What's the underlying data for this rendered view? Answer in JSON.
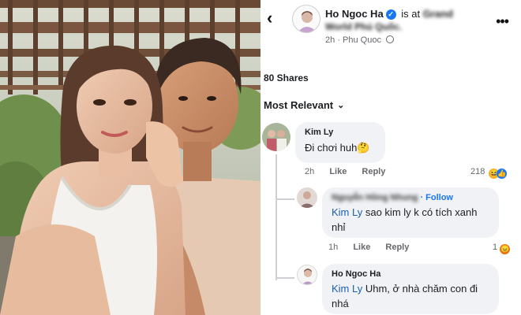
{
  "post": {
    "author": "Ho Ngoc Ha",
    "verified_icon": "✓",
    "is_at": "is at",
    "location_line1": "Grand",
    "location_line2": "World Phú Quốc.",
    "time": "2h",
    "separator": "·",
    "place": "Phu Quoc",
    "privacy_icon": "globe-icon"
  },
  "icons": {
    "back": "‹",
    "more": "•••",
    "chevron": "⌄"
  },
  "shares": "80 Shares",
  "sort_label": "Most Relevant",
  "comments": [
    {
      "author": "Kim Ly",
      "text": "Đi chơi huh",
      "emoji": "🤔",
      "time": "2h",
      "like": "Like",
      "reply": "Reply",
      "reactions": "218",
      "reaction_icons": [
        "haha",
        "like"
      ]
    },
    {
      "author": "Nguyễn Hồng Nhung",
      "follow": "· Follow",
      "mention": "Kim Ly",
      "text": " sao kim ly k có tích xanh nhỉ",
      "time": "1h",
      "like": "Like",
      "reply": "Reply",
      "reactions": "1",
      "reaction_icons": [
        "angry"
      ]
    },
    {
      "author": "Ho Ngoc Ha",
      "mention": "Kim Ly",
      "text": " Uhm, ở nhà chăm con đi nhá"
    }
  ],
  "colors": {
    "link_blue": "#1877f2",
    "mention_blue": "#1a5fb4",
    "bubble_bg": "#f0f2f5",
    "meta_gray": "#65676b"
  }
}
